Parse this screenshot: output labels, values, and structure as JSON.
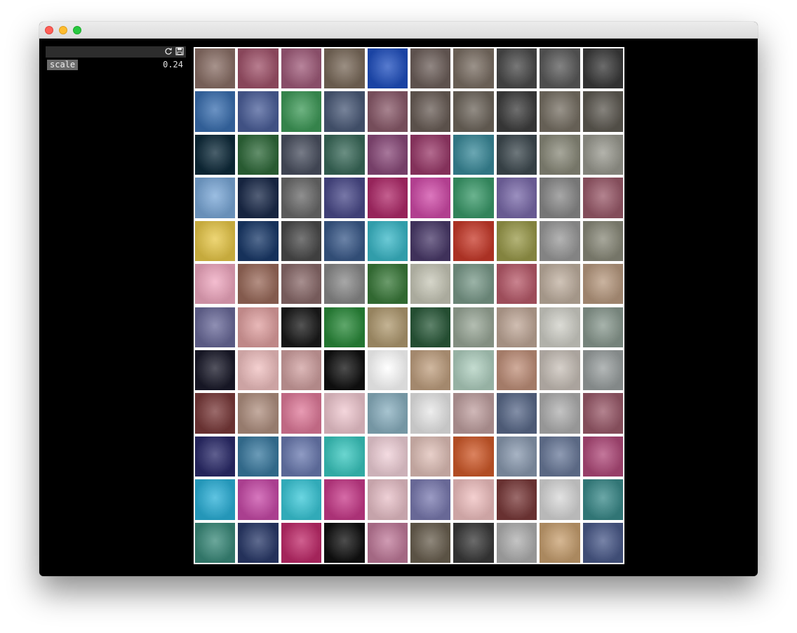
{
  "window": {
    "title": ""
  },
  "panel": {
    "params": [
      {
        "label": "scale",
        "value": "0.24"
      }
    ]
  },
  "grid": {
    "columns": 10,
    "rows": 12,
    "tiles": [
      [
        "#8a6f66",
        "#a0526a",
        "#a05b7a",
        "#7a6a5a",
        "#1f4fbf",
        "#6d5f5a",
        "#7a6e63",
        "#4a4a4a",
        "#5a5a5a",
        "#3a3a3a"
      ],
      [
        "#3a6fb0",
        "#4b5f9a",
        "#3e9a58",
        "#4a5a78",
        "#8a5a6a",
        "#6a5e57",
        "#6e665c",
        "#3e3e3e",
        "#777064",
        "#5e5a52"
      ],
      [
        "#0d2a3a",
        "#2f6a3a",
        "#4a5060",
        "#3a6a5a",
        "#8a4a7a",
        "#9a3a6a",
        "#3a8a9a",
        "#3e4a50",
        "#8a8a7a",
        "#9a9a90"
      ],
      [
        "#7aa8d8",
        "#1a2a4a",
        "#6a6a6a",
        "#4a4a8a",
        "#b02a6a",
        "#d04aa8",
        "#3a9a6a",
        "#7a6aaa",
        "#8a8a8a",
        "#9a5a6a"
      ],
      [
        "#e8c848",
        "#1a3a6a",
        "#4a4a4a",
        "#3a5a8a",
        "#3ab8c8",
        "#4a3a6a",
        "#c83a2a",
        "#9a9a4a",
        "#9a9a9a",
        "#8a8a7a"
      ],
      [
        "#f0a8c0",
        "#9a6a5a",
        "#8a6a6a",
        "#8a8a8a",
        "#3a7a3a",
        "#c8c8b8",
        "#7a9a8a",
        "#b85a6a",
        "#c0b0a0",
        "#b89a80"
      ],
      [
        "#6a6a9a",
        "#e0a0a0",
        "#1a1a1a",
        "#2a8a3a",
        "#b09a70",
        "#2a5a3a",
        "#9aa898",
        "#c0a898",
        "#d0d0c8",
        "#8a9a90"
      ],
      [
        "#1a1a2a",
        "#f0c0c0",
        "#d0a0a0",
        "#111111",
        "#ffffff",
        "#c0a080",
        "#b0d0c0",
        "#c0907a",
        "#c8c0b8",
        "#9aa0a0"
      ],
      [
        "#7a3a3a",
        "#b09080",
        "#e07a9a",
        "#f0c8d0",
        "#8ab0c0",
        "#e8e8e8",
        "#c0a0a0",
        "#5a6a8a",
        "#b0b0b0",
        "#9a5a6a"
      ],
      [
        "#2a2a6a",
        "#3a7aa0",
        "#6a7ab0",
        "#3ac8c0",
        "#f0d0d8",
        "#e0c0b8",
        "#d05a2a",
        "#8a9ab0",
        "#6a7a9a",
        "#b04a7a"
      ],
      [
        "#2ab0d8",
        "#c84aa8",
        "#3ac8d8",
        "#c83a8a",
        "#e8c0c8",
        "#7a7ab0",
        "#f0c0c0",
        "#7a3a3a",
        "#d8d8d8",
        "#3a8a8a"
      ],
      [
        "#3a8a7a",
        "#2a3a6a",
        "#c02a6a",
        "#111111",
        "#c07a9a",
        "#6a6050",
        "#3a3a3a",
        "#b0b0b0",
        "#c8a070",
        "#4a5a8a"
      ]
    ]
  }
}
